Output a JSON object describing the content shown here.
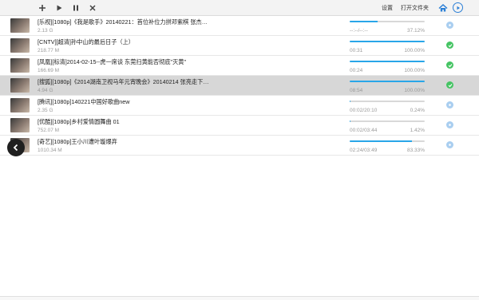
{
  "toolbar": {
    "settings_label": "设置",
    "open_folder_label": "打开文件夹"
  },
  "accent_colors": {
    "progress": "#29a6e8",
    "done": "#45c463",
    "nav": "#2b7fd6"
  },
  "downloads": [
    {
      "title": "[乐视][1080p]《我是歌手》20140221：首位补位力拼邓紫棋 张杰…",
      "size": "2.13 G",
      "time": "--:--/--:--",
      "percent": "37.12%",
      "progress": 37.12,
      "status": "waiting",
      "selected": false
    },
    {
      "title": "[CNTV][超清]孙中山的最后日子（上）",
      "size": "218.77 M",
      "time": "00:31",
      "percent": "100.00%",
      "progress": 100,
      "status": "done",
      "selected": false
    },
    {
      "title": "[凤凰][标清]2014-02-15--虎一席谈 东莞扫黄能否彻底\"灭黄\"",
      "size": "166.69 M",
      "time": "00:24",
      "percent": "100.00%",
      "progress": 100,
      "status": "done",
      "selected": false
    },
    {
      "title": "[搜狐][1080p]《2014湖南卫视马年元宵晚会》20140214 张亮走下…",
      "size": "4.94 G",
      "time": "08:54",
      "percent": "100.00%",
      "progress": 100,
      "status": "done",
      "selected": true
    },
    {
      "title": "[腾讯][1080p]140221中国好歌曲new",
      "size": "2.35 G",
      "time": "00:02/20:10",
      "percent": "0.24%",
      "progress": 0.24,
      "status": "waiting",
      "selected": false
    },
    {
      "title": "[优酷][1080p]乡村爱情圆舞曲 01",
      "size": "752.07 M",
      "time": "00:02/03:44",
      "percent": "1.42%",
      "progress": 1.42,
      "status": "waiting",
      "selected": false
    },
    {
      "title": "[奇艺][1080p]王小川遭叶璇爆弃",
      "size": "1010.34 M",
      "time": "02:24/03:49",
      "percent": "83.33%",
      "progress": 83.33,
      "status": "waiting",
      "selected": false
    }
  ]
}
